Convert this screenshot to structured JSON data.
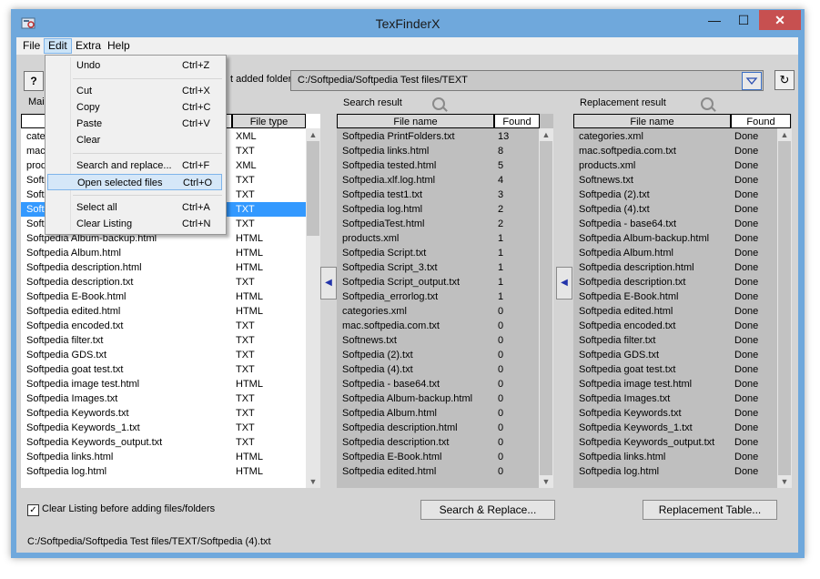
{
  "window": {
    "title": "TexFinderX",
    "minimize": "—",
    "maximize": "☐",
    "close": "✕"
  },
  "menubar": {
    "file": "File",
    "edit": "Edit",
    "extra": "Extra",
    "help": "Help"
  },
  "toolbar": {
    "help_button": "?",
    "last_folder_label": "t added folder:",
    "path": "C:/Softpedia/Softpedia Test files/TEXT",
    "refresh": "↻"
  },
  "left_list": {
    "header_partial": "Mai",
    "col_type": "File type",
    "rows": [
      {
        "name": "cate",
        "type": "XML"
      },
      {
        "name": "mac",
        "type": "TXT"
      },
      {
        "name": "prod",
        "type": "XML"
      },
      {
        "name": "Soft",
        "type": "TXT"
      },
      {
        "name": "Soft",
        "type": "TXT"
      },
      {
        "name": "Soft",
        "type": "TXT"
      },
      {
        "name": "Soft",
        "type": "TXT"
      },
      {
        "name": "Softpedia Album-backup.html",
        "type": "HTML"
      },
      {
        "name": "Softpedia Album.html",
        "type": "HTML"
      },
      {
        "name": "Softpedia description.html",
        "type": "HTML"
      },
      {
        "name": "Softpedia description.txt",
        "type": "TXT"
      },
      {
        "name": "Softpedia E-Book.html",
        "type": "HTML"
      },
      {
        "name": "Softpedia edited.html",
        "type": "HTML"
      },
      {
        "name": "Softpedia encoded.txt",
        "type": "TXT"
      },
      {
        "name": "Softpedia filter.txt",
        "type": "TXT"
      },
      {
        "name": "Softpedia GDS.txt",
        "type": "TXT"
      },
      {
        "name": "Softpedia goat test.txt",
        "type": "TXT"
      },
      {
        "name": "Softpedia image test.html",
        "type": "HTML"
      },
      {
        "name": "Softpedia Images.txt",
        "type": "TXT"
      },
      {
        "name": "Softpedia Keywords.txt",
        "type": "TXT"
      },
      {
        "name": "Softpedia Keywords_1.txt",
        "type": "TXT"
      },
      {
        "name": "Softpedia Keywords_output.txt",
        "type": "TXT"
      },
      {
        "name": "Softpedia links.html",
        "type": "HTML"
      },
      {
        "name": "Softpedia log.html",
        "type": "HTML"
      }
    ],
    "selected_index": 5
  },
  "search": {
    "title": "Search result",
    "col_name": "File name",
    "col_found": "Found",
    "rows": [
      {
        "name": "Softpedia PrintFolders.txt",
        "found": "13"
      },
      {
        "name": "Softpedia links.html",
        "found": "8"
      },
      {
        "name": "Softpedia tested.html",
        "found": "5"
      },
      {
        "name": "Softpedia.xlf.log.html",
        "found": "4"
      },
      {
        "name": "Softpedia test1.txt",
        "found": "3"
      },
      {
        "name": "Softpedia log.html",
        "found": "2"
      },
      {
        "name": "SoftpediaTest.html",
        "found": "2"
      },
      {
        "name": "products.xml",
        "found": "1"
      },
      {
        "name": "Softpedia Script.txt",
        "found": "1"
      },
      {
        "name": "Softpedia Script_3.txt",
        "found": "1"
      },
      {
        "name": "Softpedia Script_output.txt",
        "found": "1"
      },
      {
        "name": "Softpedia_errorlog.txt",
        "found": "1"
      },
      {
        "name": "categories.xml",
        "found": "0"
      },
      {
        "name": "mac.softpedia.com.txt",
        "found": "0"
      },
      {
        "name": "Softnews.txt",
        "found": "0"
      },
      {
        "name": "Softpedia (2).txt",
        "found": "0"
      },
      {
        "name": "Softpedia (4).txt",
        "found": "0"
      },
      {
        "name": "Softpedia - base64.txt",
        "found": "0"
      },
      {
        "name": "Softpedia Album-backup.html",
        "found": "0"
      },
      {
        "name": "Softpedia Album.html",
        "found": "0"
      },
      {
        "name": "Softpedia description.html",
        "found": "0"
      },
      {
        "name": "Softpedia description.txt",
        "found": "0"
      },
      {
        "name": "Softpedia E-Book.html",
        "found": "0"
      },
      {
        "name": "Softpedia edited.html",
        "found": "0"
      }
    ]
  },
  "replace": {
    "title": "Replacement result",
    "col_name": "File name",
    "col_found": "Found",
    "rows": [
      {
        "name": "categories.xml",
        "found": "Done"
      },
      {
        "name": "mac.softpedia.com.txt",
        "found": "Done"
      },
      {
        "name": "products.xml",
        "found": "Done"
      },
      {
        "name": "Softnews.txt",
        "found": "Done"
      },
      {
        "name": "Softpedia (2).txt",
        "found": "Done"
      },
      {
        "name": "Softpedia (4).txt",
        "found": "Done"
      },
      {
        "name": "Softpedia - base64.txt",
        "found": "Done"
      },
      {
        "name": "Softpedia Album-backup.html",
        "found": "Done"
      },
      {
        "name": "Softpedia Album.html",
        "found": "Done"
      },
      {
        "name": "Softpedia description.html",
        "found": "Done"
      },
      {
        "name": "Softpedia description.txt",
        "found": "Done"
      },
      {
        "name": "Softpedia E-Book.html",
        "found": "Done"
      },
      {
        "name": "Softpedia edited.html",
        "found": "Done"
      },
      {
        "name": "Softpedia encoded.txt",
        "found": "Done"
      },
      {
        "name": "Softpedia filter.txt",
        "found": "Done"
      },
      {
        "name": "Softpedia GDS.txt",
        "found": "Done"
      },
      {
        "name": "Softpedia goat test.txt",
        "found": "Done"
      },
      {
        "name": "Softpedia image test.html",
        "found": "Done"
      },
      {
        "name": "Softpedia Images.txt",
        "found": "Done"
      },
      {
        "name": "Softpedia Keywords.txt",
        "found": "Done"
      },
      {
        "name": "Softpedia Keywords_1.txt",
        "found": "Done"
      },
      {
        "name": "Softpedia Keywords_output.txt",
        "found": "Done"
      },
      {
        "name": "Softpedia links.html",
        "found": "Done"
      },
      {
        "name": "Softpedia log.html",
        "found": "Done"
      }
    ]
  },
  "edit_menu": {
    "items": [
      {
        "label": "Undo",
        "shortcut": "Ctrl+Z"
      },
      {
        "label": "Cut",
        "shortcut": "Ctrl+X"
      },
      {
        "label": "Copy",
        "shortcut": "Ctrl+C"
      },
      {
        "label": "Paste",
        "shortcut": "Ctrl+V"
      },
      {
        "label": "Clear",
        "shortcut": ""
      },
      {
        "label": "Search and replace...",
        "shortcut": "Ctrl+F"
      },
      {
        "label": "Open selected files",
        "shortcut": "Ctrl+O"
      },
      {
        "label": "Select all",
        "shortcut": "Ctrl+A"
      },
      {
        "label": "Clear Listing",
        "shortcut": "Ctrl+N"
      }
    ]
  },
  "bottom": {
    "checkbox_label": "Clear Listing before adding files/folders",
    "checkbox_mark": "✓",
    "search_replace_button": "Search & Replace...",
    "replacement_table_button": "Replacement Table...",
    "status_path": "C:/Softpedia/Softpedia Test files/TEXT/Softpedia (4).txt"
  },
  "colors": {
    "titlebar": "#6fa8dc",
    "close": "#c75050",
    "selection": "#3399ff"
  }
}
